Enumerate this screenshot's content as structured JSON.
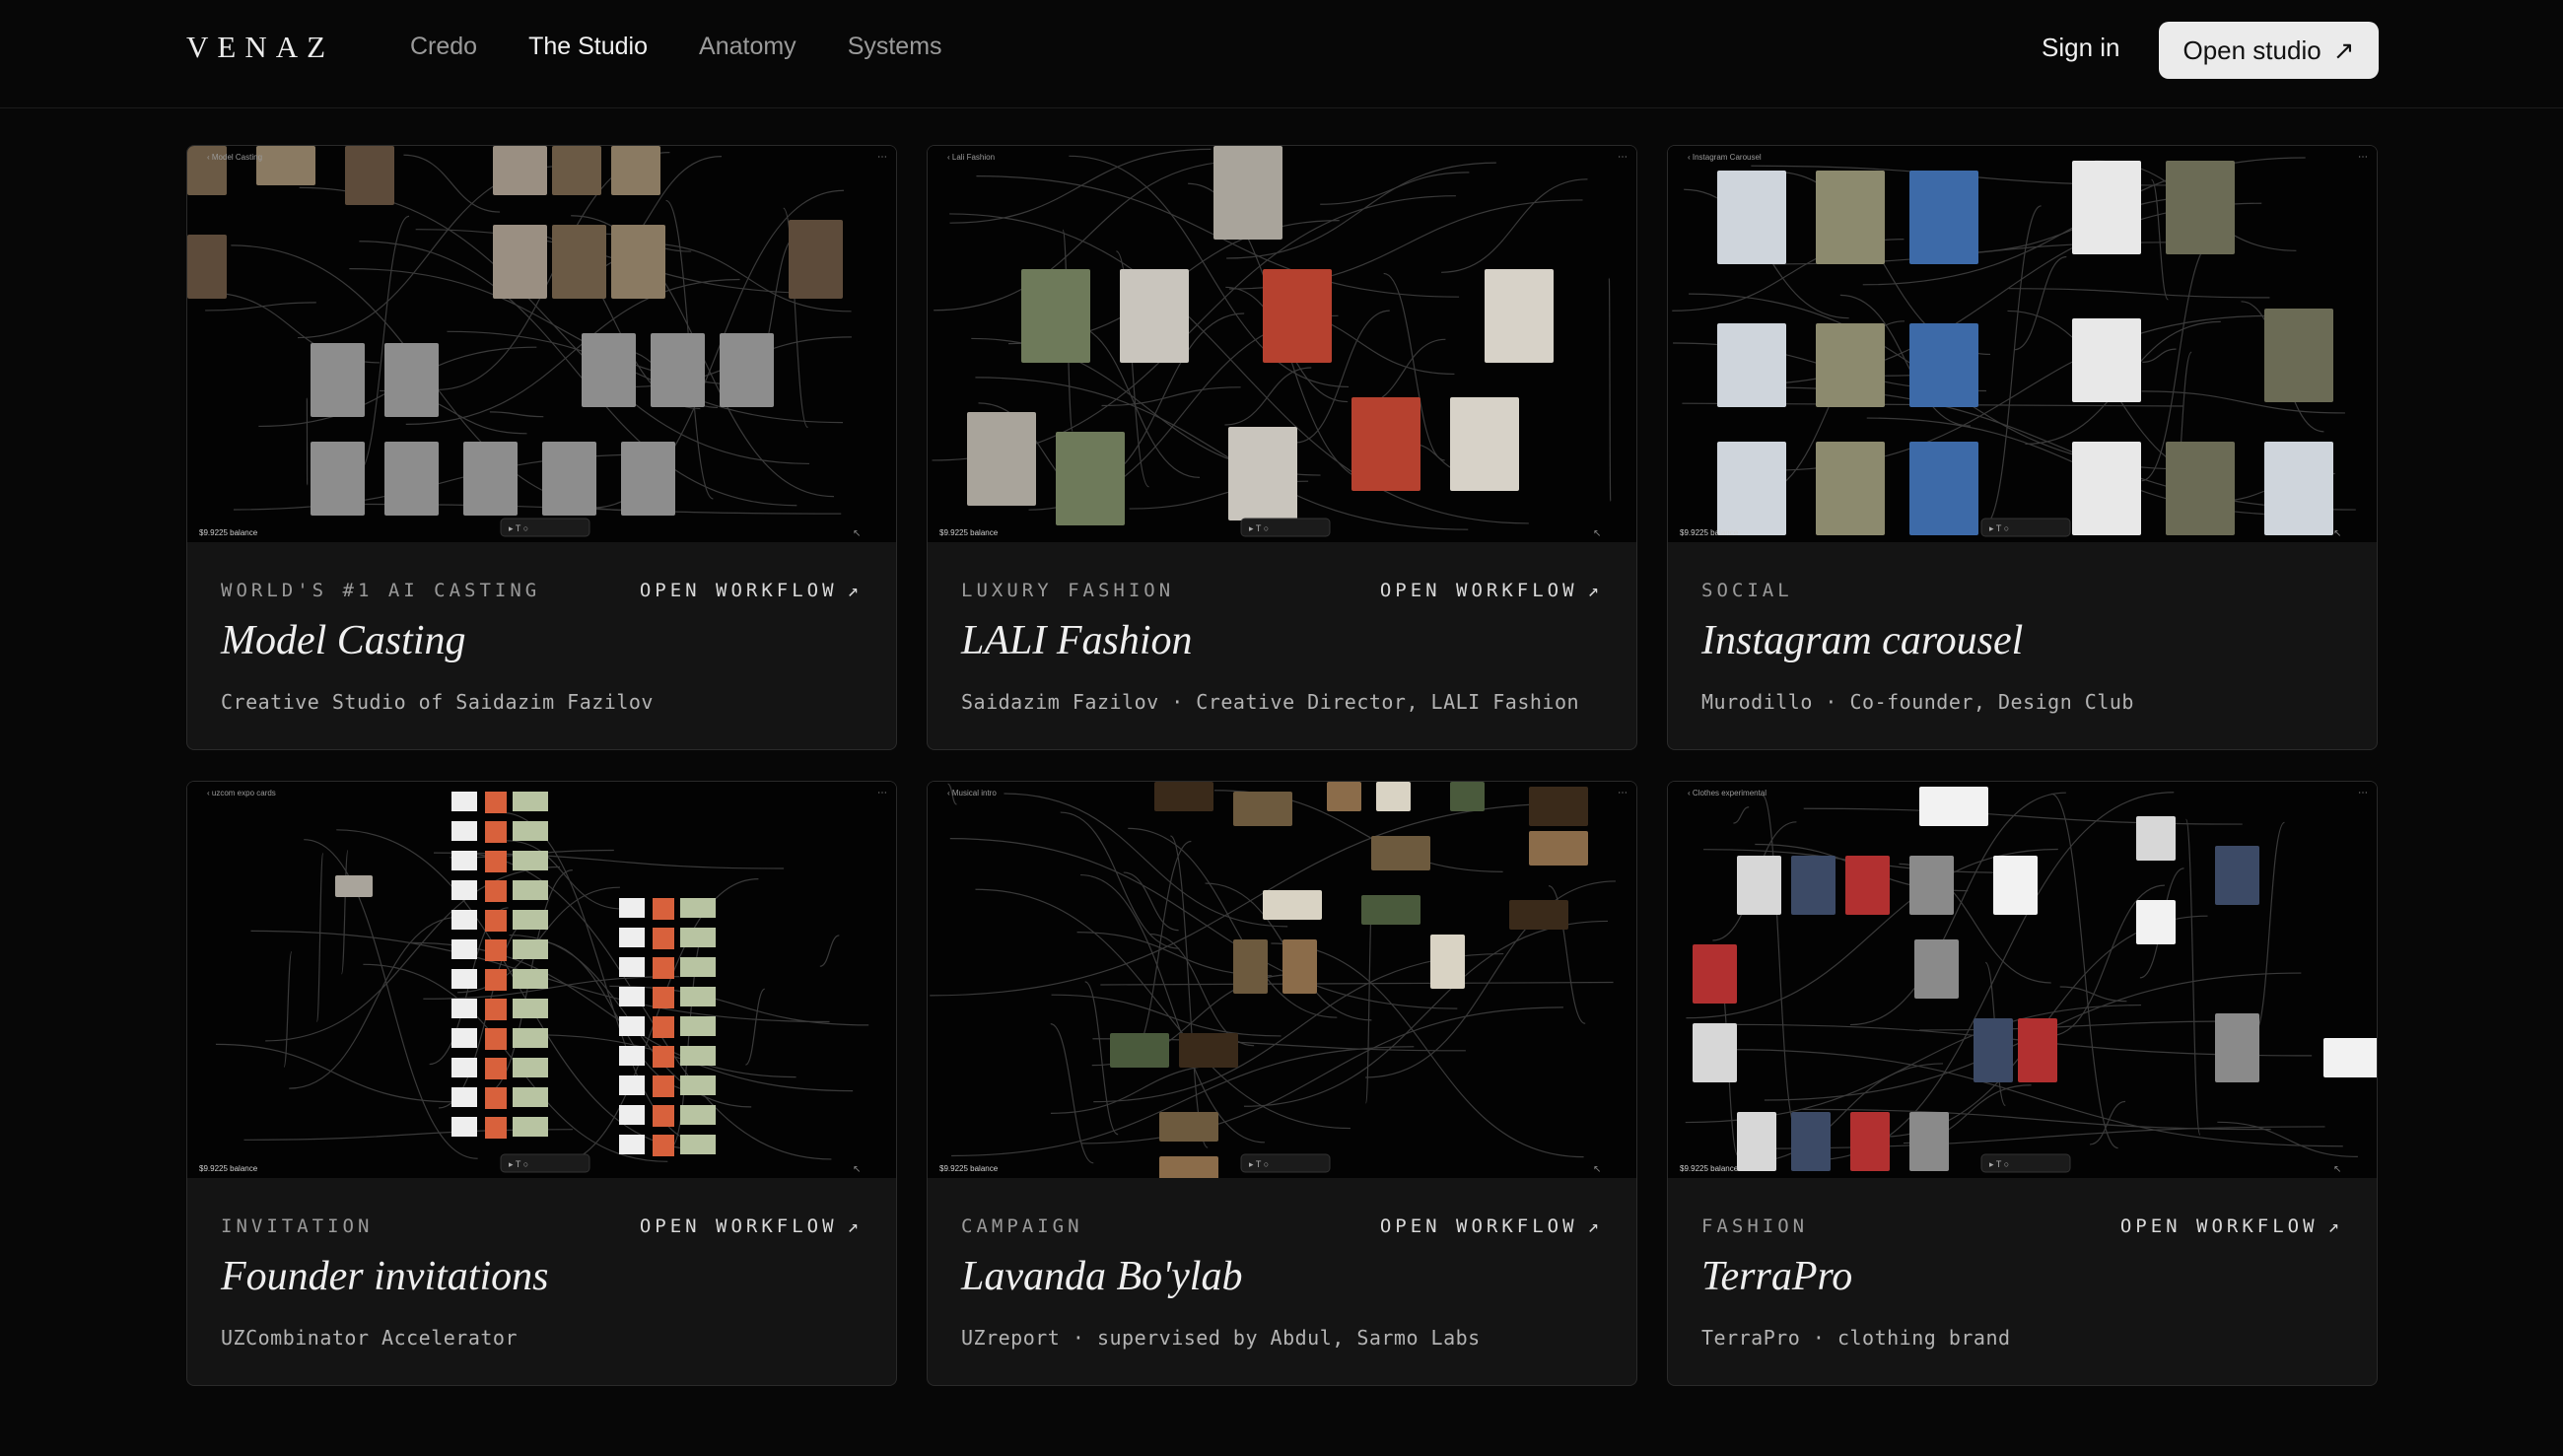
{
  "header": {
    "logo": "VENAZ",
    "nav": [
      "Credo",
      "The Studio",
      "Anatomy",
      "Systems"
    ],
    "sign_in": "Sign in",
    "open_studio": "Open studio",
    "arrow": "↗"
  },
  "cards": [
    {
      "category": "WORLD'S #1 AI CASTING",
      "workflow": "OPEN WORKFLOW",
      "title": "Model Casting",
      "subtitle": "Creative Studio of Saidazim Fazilov",
      "preview_label": "Model Casting",
      "preview_kind": "casting"
    },
    {
      "category": "LUXURY FASHION",
      "workflow": "OPEN WORKFLOW",
      "title": "LALI Fashion",
      "subtitle": "Saidazim Fazilov · Creative Director, LALI Fashion",
      "preview_label": "Lali Fashion",
      "preview_kind": "lali"
    },
    {
      "category": "SOCIAL",
      "workflow": "",
      "title": "Instagram carousel",
      "subtitle": "Murodillo · Co-founder, Design Club",
      "preview_label": "Instagram Carousel",
      "preview_kind": "insta"
    },
    {
      "category": "INVITATION",
      "workflow": "OPEN WORKFLOW",
      "title": "Founder invitations",
      "subtitle": "UZCombinator Accelerator",
      "preview_label": "uzcom expo cards",
      "preview_kind": "founder"
    },
    {
      "category": "CAMPAIGN",
      "workflow": "OPEN WORKFLOW",
      "title": "Lavanda Bo'ylab",
      "subtitle": "UZreport · supervised by Abdul, Sarmo Labs",
      "preview_label": "Musical intro",
      "preview_kind": "lavanda"
    },
    {
      "category": "FASHION",
      "workflow": "OPEN WORKFLOW",
      "title": "TerraPro",
      "subtitle": "TerraPro · clothing brand",
      "preview_label": "Clothes experimental",
      "preview_kind": "terra"
    }
  ],
  "preview_balance": "$9.9225",
  "preview_balance_caption": "balance",
  "colors": {
    "bg": "#070707",
    "card": "#141414",
    "accent": "#ebebeb"
  }
}
